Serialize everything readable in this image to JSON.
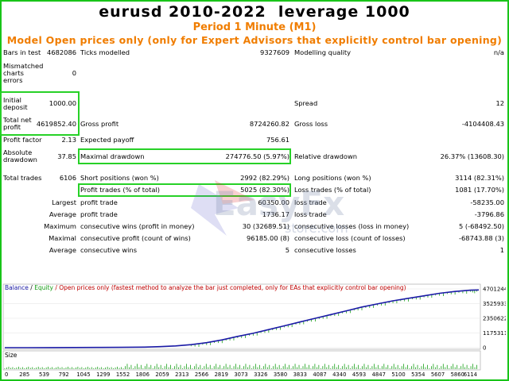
{
  "header": {
    "title": "eurusd 2010-2022  leverage 1000",
    "period": "Period  1 Minute (M1)",
    "model": "Model  Open prices only (only for Expert Advisors that explicitly control bar opening)"
  },
  "report": {
    "bars_in_test_label": "Bars in test",
    "bars_in_test": "4682086",
    "ticks_modelled_label": "Ticks modelled",
    "ticks_modelled": "9327609",
    "modelling_quality_label": "Modelling quality",
    "modelling_quality": "n/a",
    "mismatched_label_1": "Mismatched",
    "mismatched_label_2": "charts",
    "mismatched_label_3": "errors",
    "mismatched": "0",
    "initial_deposit_label_1": "Initial",
    "initial_deposit_label_2": "deposit",
    "initial_deposit": "1000.00",
    "spread_label": "Spread",
    "spread": "12",
    "total_net_profit_label_1": "Total net",
    "total_net_profit_label_2": "profit",
    "total_net_profit": "4619852.40",
    "gross_profit_label": "Gross profit",
    "gross_profit": "8724260.82",
    "gross_loss_label": "Gross loss",
    "gross_loss": "-4104408.43",
    "profit_factor_label": "Profit factor",
    "profit_factor": "2.13",
    "expected_payoff_label": "Expected payoff",
    "expected_payoff": "756.61",
    "absolute_drawdown_label_1": "Absolute",
    "absolute_drawdown_label_2": "drawdown",
    "absolute_drawdown": "37.85",
    "maximal_drawdown_label": "Maximal drawdown",
    "maximal_drawdown": "274776.50 (5.97%)",
    "relative_drawdown_label": "Relative drawdown",
    "relative_drawdown": "26.37% (13608.30)",
    "total_trades_label": "Total trades",
    "total_trades": "6106",
    "short_positions_label": "Short positions (won %)",
    "short_positions": "2992 (82.29%)",
    "long_positions_label": "Long positions (won %)",
    "long_positions": "3114 (82.31%)",
    "profit_trades_label": "Profit trades (% of total)",
    "profit_trades": "5025 (82.30%)",
    "loss_trades_label": "Loss trades (% of total)",
    "loss_trades": "1081 (17.70%)",
    "largest_label": "Largest",
    "largest_profit_label": "profit trade",
    "largest_profit": "60350.00",
    "largest_loss_label": "loss trade",
    "largest_loss": "-58235.00",
    "average_label": "Average",
    "average_profit_label": "profit trade",
    "average_profit": "1736.17",
    "average_loss_label": "loss trade",
    "average_loss": "-3796.86",
    "maximum_label": "Maximum",
    "max_cons_wins_label": "consecutive wins (profit in money)",
    "max_cons_wins": "30 (32689.51)",
    "max_cons_losses_label": "consecutive losses (loss in money)",
    "max_cons_losses": "5 (-68492.50)",
    "maximal_label": "Maximal",
    "maximal_cons_profit_label": "consecutive profit (count of wins)",
    "maximal_cons_profit": "96185.00 (8)",
    "maximal_cons_loss_label": "consecutive loss (count of losses)",
    "maximal_cons_loss": "-68743.88 (3)",
    "average2_label": "Average",
    "avg_cons_wins_label": "consecutive wins",
    "avg_cons_wins": "5",
    "avg_cons_losses_label": "consecutive losses",
    "avg_cons_losses": "1"
  },
  "watermark": {
    "text": "EasyFx",
    "sub": "store.com"
  },
  "chart_data": {
    "type": "line",
    "legend_balance": "Balance",
    "legend_sep": " / ",
    "legend_equity": "Equity",
    "legend_rest": " / Open prices only (fastest method to analyze the bar just completed, only for EAs that explicitly control bar opening)",
    "size_label": "Size",
    "series": [
      {
        "name": "Balance",
        "color": "#1a1aa6"
      },
      {
        "name": "Equity",
        "color": "#18a018"
      }
    ],
    "y_ticks": [
      "4701244",
      "3525933",
      "2350622",
      "1175311",
      "0"
    ],
    "y_tick_values": [
      4701244,
      3525933,
      2350622,
      1175311,
      0
    ],
    "x_ticks": [
      "0",
      "285",
      "539",
      "792",
      "1045",
      "1299",
      "1552",
      "1806",
      "2059",
      "2313",
      "2566",
      "2819",
      "3073",
      "3326",
      "3580",
      "3833",
      "4087",
      "4340",
      "4593",
      "4847",
      "5100",
      "5354",
      "5607",
      "5860",
      "6114"
    ],
    "xlim": [
      0,
      6106
    ],
    "ylim": [
      0,
      4701244
    ],
    "x": [
      0,
      300,
      600,
      900,
      1200,
      1500,
      1800,
      2000,
      2200,
      2400,
      2600,
      2800,
      3000,
      3200,
      3400,
      3600,
      3800,
      4000,
      4200,
      4400,
      4600,
      4800,
      5000,
      5200,
      5400,
      5600,
      5800,
      6000,
      6106
    ],
    "balance": [
      1000,
      3000,
      6000,
      10000,
      16000,
      25000,
      45000,
      80000,
      140000,
      240000,
      400000,
      620000,
      900000,
      1150000,
      1450000,
      1750000,
      2050000,
      2350000,
      2650000,
      2950000,
      3250000,
      3500000,
      3750000,
      3950000,
      4150000,
      4350000,
      4500000,
      4600000,
      4620852
    ],
    "colors": {
      "axis_bg": "#ffffff",
      "grid": "#d0d0d0",
      "balance": "#1a1aa6",
      "equity": "#18a018",
      "volume": "#18a018",
      "accent_box": "#27d127",
      "heading_orange": "#f07d00"
    }
  }
}
